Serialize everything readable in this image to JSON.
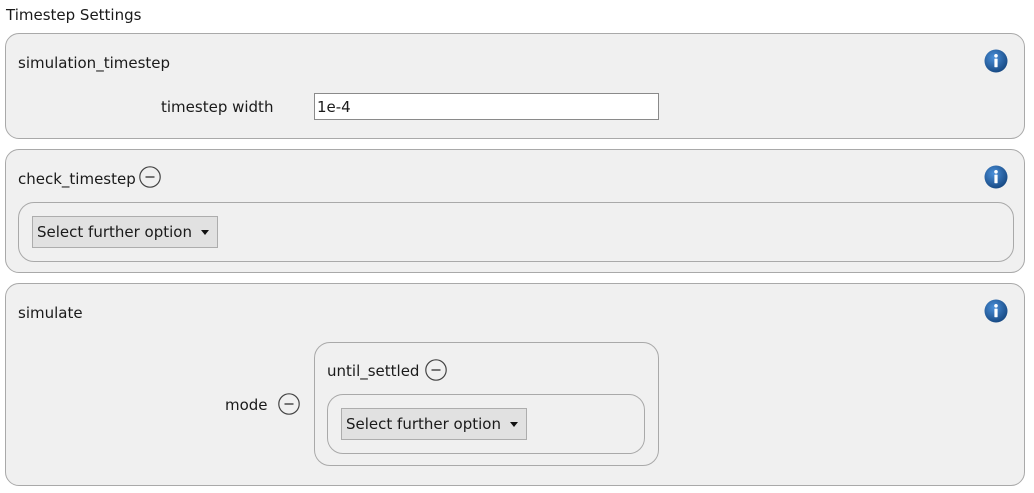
{
  "page_title": "Timestep Settings",
  "panels": {
    "simulation_timestep": {
      "title": "simulation_timestep",
      "field_label": "timestep width",
      "field_value": "1e-4"
    },
    "check_timestep": {
      "title": "check_timestep",
      "dropdown_label": "Select further option"
    },
    "simulate": {
      "title": "simulate",
      "mode_label": "mode",
      "sub_title": "until_settled",
      "dropdown_label": "Select further option"
    }
  },
  "colors": {
    "panel_bg": "#f0f0f0",
    "panel_border": "#a9a9a9",
    "info_icon_blue": "#1f5ea8"
  },
  "icons": [
    "info-icon",
    "minus-circle-icon",
    "caret-down-icon"
  ]
}
